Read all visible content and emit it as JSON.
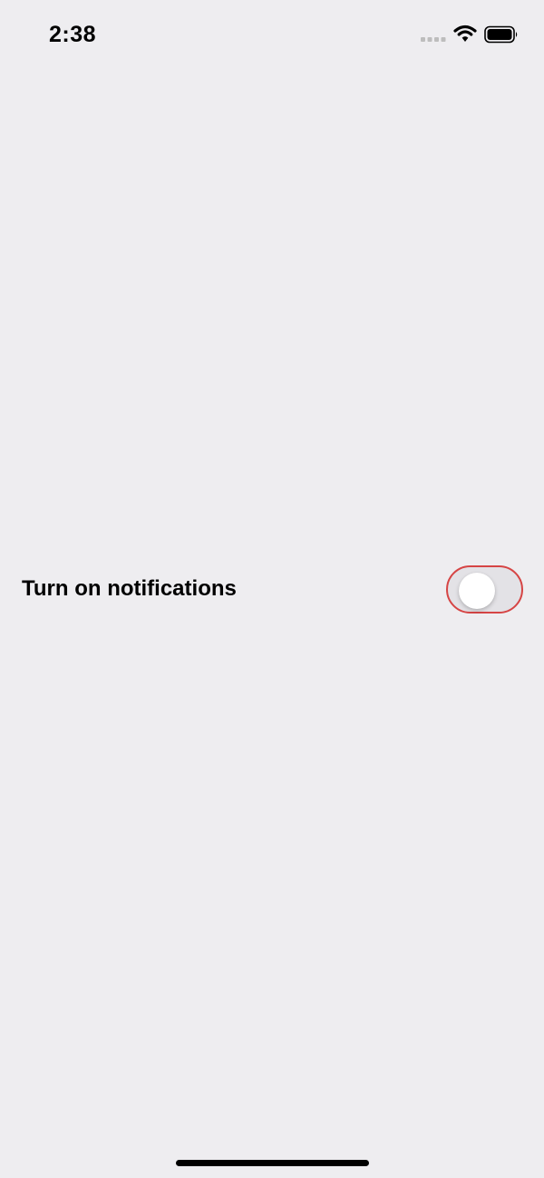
{
  "status_bar": {
    "time": "2:38",
    "icons": [
      "cellular-signal-icon",
      "wifi-icon",
      "battery-icon"
    ]
  },
  "settings": {
    "notifications": {
      "label": "Turn on notifications",
      "toggle_on": false
    }
  },
  "colors": {
    "background": "#EEEDF0",
    "toggle_track": "#E3E2E6",
    "highlight_border": "#D64545",
    "knob": "#FFFFFF"
  }
}
